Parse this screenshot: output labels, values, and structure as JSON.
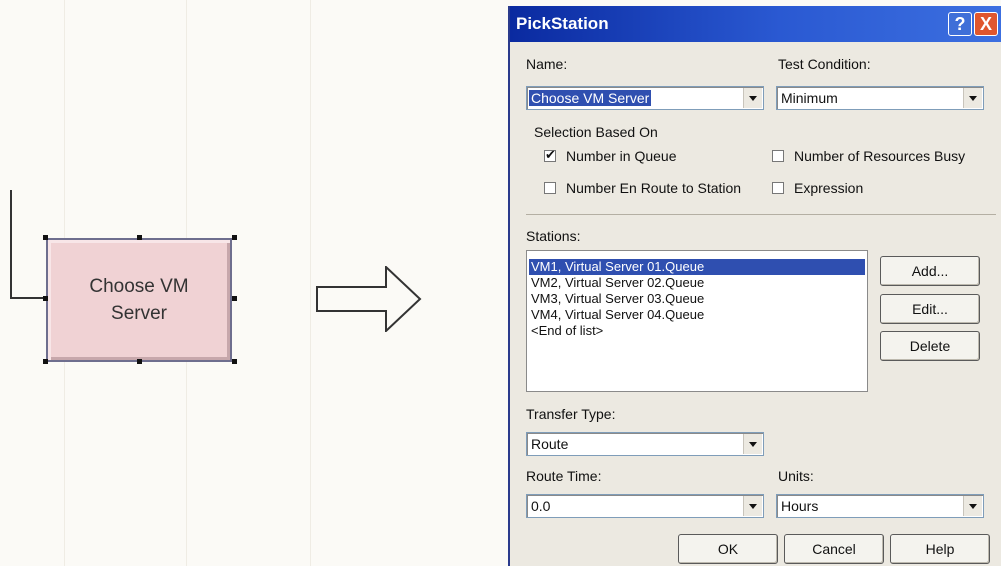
{
  "module": {
    "label": "Choose VM Server"
  },
  "dialog": {
    "title": "PickStation",
    "name_label": "Name:",
    "name_value": "Choose VM Server",
    "test_condition_label": "Test Condition:",
    "test_condition_value": "Minimum",
    "selection_label": "Selection Based On",
    "options": {
      "number_in_queue": {
        "label": "Number in Queue",
        "checked": true
      },
      "number_resources_busy": {
        "label": "Number of Resources Busy",
        "checked": false
      },
      "number_en_route": {
        "label": "Number En Route to Station",
        "checked": false
      },
      "expression": {
        "label": "Expression",
        "checked": false
      }
    },
    "stations_label": "Stations:",
    "stations": [
      "VM1, Virtual Server 01.Queue",
      "VM2, Virtual Server 02.Queue",
      "VM3, Virtual Server 03.Queue",
      "VM4, Virtual Server 04.Queue",
      "<End of list>"
    ],
    "add_label": "Add...",
    "edit_label": "Edit...",
    "delete_label": "Delete",
    "transfer_type_label": "Transfer Type:",
    "transfer_type_value": "Route",
    "route_time_label": "Route Time:",
    "route_time_value": "0.0",
    "units_label": "Units:",
    "units_value": "Hours",
    "ok_label": "OK",
    "cancel_label": "Cancel",
    "help_label": "Help",
    "help_glyph": "?",
    "close_glyph": "X"
  }
}
